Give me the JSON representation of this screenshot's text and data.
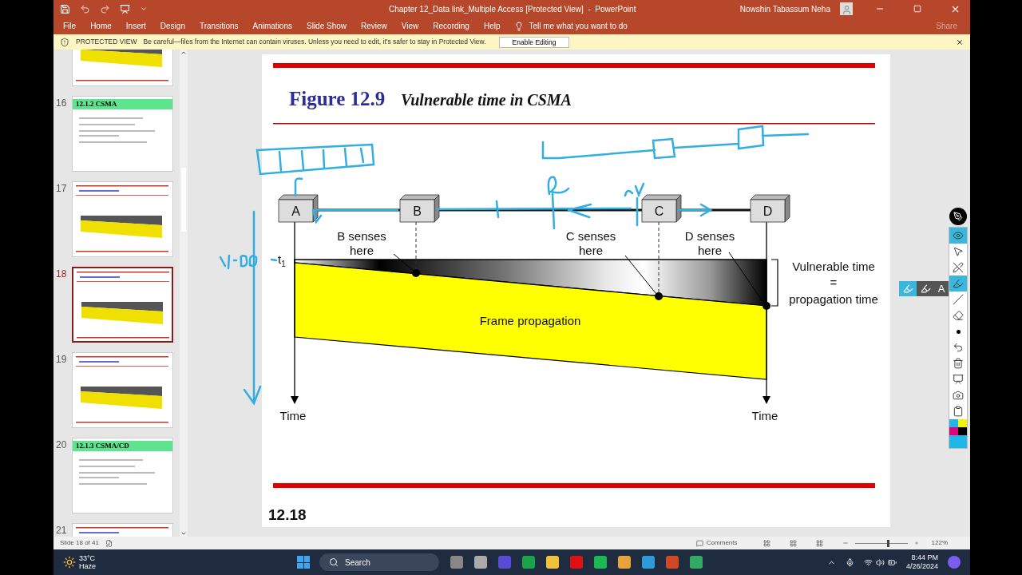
{
  "window": {
    "title": "Chapter 12_Data link_Multiple Access [Protected View]  -  PowerPoint",
    "user": "Nowshin Tabassum Neha"
  },
  "ribbon": {
    "tabs": [
      "File",
      "Home",
      "Insert",
      "Design",
      "Transitions",
      "Animations",
      "Slide Show",
      "Review",
      "View",
      "Recording",
      "Help"
    ],
    "tell_me": "Tell me what you want to do",
    "share": "Share"
  },
  "protected_bar": {
    "label": "PROTECTED VIEW",
    "message": "Be careful—files from the Internet can contain viruses. Unless you need to edit, it's safer to stay in Protected View.",
    "button": "Enable Editing"
  },
  "thumbnails": [
    {
      "kind": "figure",
      "selected": false
    },
    {
      "number": "16",
      "kind": "section",
      "heading": "12.1.2  CSMA",
      "selected": false
    },
    {
      "number": "17",
      "kind": "figure",
      "selected": false
    },
    {
      "number": "18",
      "kind": "figure",
      "selected": true
    },
    {
      "number": "19",
      "kind": "figure",
      "selected": false
    },
    {
      "number": "20",
      "kind": "section",
      "heading": "12.1.3  CSMA/CD",
      "selected": false
    },
    {
      "number": "21",
      "kind": "figure",
      "selected": false
    }
  ],
  "slide": {
    "figure": "Figure 12.9",
    "caption": "Vulnerable time in CSMA",
    "stations": [
      "A",
      "B",
      "C",
      "D"
    ],
    "senses": [
      {
        "line1": "B senses",
        "line2": "here"
      },
      {
        "line1": "C senses",
        "line2": "here"
      },
      {
        "line1": "D senses",
        "line2": "here"
      }
    ],
    "t_label": "t",
    "t_sub": "1",
    "vulnerable": [
      "Vulnerable time",
      "=",
      "propagation time"
    ],
    "frame_label": "Frame propagation",
    "time_labels": [
      "Time",
      "Time"
    ],
    "footer": "12.18"
  },
  "pen_tools": [
    {
      "kind": "eye",
      "selected": true
    },
    {
      "kind": "pointer",
      "selected": false
    },
    {
      "kind": "no-pen",
      "selected": false
    },
    {
      "kind": "highlighter",
      "selected": true
    },
    {
      "kind": "line",
      "selected": false
    },
    {
      "kind": "eraser",
      "selected": false
    },
    {
      "kind": "dot",
      "selected": false
    },
    {
      "kind": "undo",
      "selected": false
    },
    {
      "kind": "trash",
      "selected": false
    },
    {
      "kind": "board",
      "selected": false
    },
    {
      "kind": "camera",
      "selected": false
    },
    {
      "kind": "clipboard",
      "selected": false
    }
  ],
  "pen_flyout": {
    "text_tool": "A"
  },
  "status_bar": {
    "slide": "Slide 18 of 41",
    "comments": "Comments",
    "zoom": "122%",
    "level": 0.62
  },
  "taskbar": {
    "temperature": "33°C",
    "weather": "Haze",
    "search": "Search",
    "time": "8:44 PM",
    "date": "4/26/2024"
  }
}
